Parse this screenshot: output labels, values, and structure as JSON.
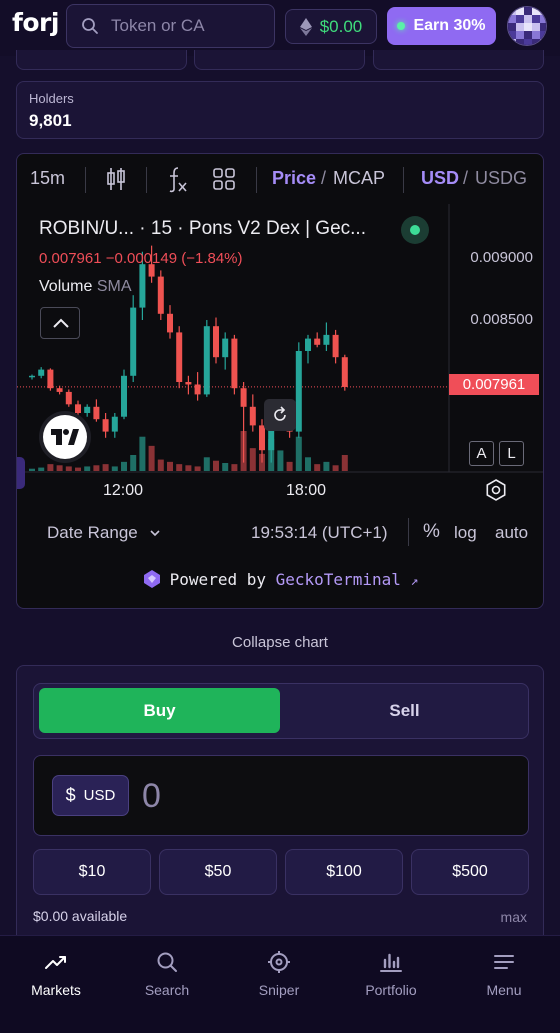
{
  "header": {
    "logo": "forj",
    "search_placeholder": "Token or CA",
    "balance": "$0.00",
    "earn_label": "Earn 30%",
    "avatar_colors": [
      "#3a2a7a",
      "#c9c0ef",
      "#8877d6",
      "#e8e4fa",
      "#4b3a9a"
    ]
  },
  "stats": {
    "holders_label": "Holders",
    "holders_value": "9,801"
  },
  "chart": {
    "toolbar": {
      "interval": "15m",
      "price_label": "Price",
      "sep1": "/",
      "mcap_label": "MCAP",
      "usd_label": "USD",
      "sep2": "/",
      "usdg_label": "USDG"
    },
    "symbol_line": "ROBIN/U... · 15 · Pons V2 Dex | Gec...",
    "ohlc_line": "0.007961  −0.000149 (−1.84%)",
    "volume_label": "Volume",
    "volume_indicator": "SMA",
    "y_axis_labels": [
      "0.009000",
      "0.008500"
    ],
    "current_price_tag": "0.007961",
    "x_axis_labels": [
      "12:00",
      "18:00"
    ],
    "auto_label_a": "A",
    "auto_label_l": "L",
    "date_range_label": "Date Range",
    "timestamp": "19:53:14 (UTC+1)",
    "percent_label": "%",
    "log_label": "log",
    "auto_label": "auto",
    "powered_prefix": "Powered by",
    "powered_brand": "GeckoTerminal",
    "powered_arrow": "↗",
    "colors": {
      "up": "#26a69a",
      "down": "#ef5350",
      "tag": "#f04e58"
    }
  },
  "chart_data": {
    "type": "candlestick",
    "title": "ROBIN/U... · 15 · Pons V2 Dex | Gec...",
    "y_ticks": [
      0.009,
      0.0085
    ],
    "x_ticks": [
      "12:00",
      "18:00"
    ],
    "last_price": 0.007961,
    "change": -0.000149,
    "change_pct": -1.84,
    "candles": [
      {
        "o": 0.00804,
        "h": 0.00806,
        "l": 0.00802,
        "c": 0.00805
      },
      {
        "o": 0.00805,
        "h": 0.00812,
        "l": 0.00803,
        "c": 0.0081
      },
      {
        "o": 0.0081,
        "h": 0.00811,
        "l": 0.00793,
        "c": 0.00795
      },
      {
        "o": 0.00795,
        "h": 0.00797,
        "l": 0.0079,
        "c": 0.00792
      },
      {
        "o": 0.00792,
        "h": 0.00794,
        "l": 0.0078,
        "c": 0.00782
      },
      {
        "o": 0.00782,
        "h": 0.00785,
        "l": 0.0077,
        "c": 0.00775
      },
      {
        "o": 0.00775,
        "h": 0.00782,
        "l": 0.00772,
        "c": 0.0078
      },
      {
        "o": 0.0078,
        "h": 0.00786,
        "l": 0.00768,
        "c": 0.0077
      },
      {
        "o": 0.0077,
        "h": 0.00775,
        "l": 0.00755,
        "c": 0.0076
      },
      {
        "o": 0.0076,
        "h": 0.00775,
        "l": 0.00755,
        "c": 0.00772
      },
      {
        "o": 0.00772,
        "h": 0.0081,
        "l": 0.0077,
        "c": 0.00805
      },
      {
        "o": 0.00805,
        "h": 0.0087,
        "l": 0.008,
        "c": 0.0086
      },
      {
        "o": 0.0086,
        "h": 0.00905,
        "l": 0.0085,
        "c": 0.00895
      },
      {
        "o": 0.00895,
        "h": 0.0091,
        "l": 0.0088,
        "c": 0.00885
      },
      {
        "o": 0.00885,
        "h": 0.0089,
        "l": 0.0085,
        "c": 0.00855
      },
      {
        "o": 0.00855,
        "h": 0.00862,
        "l": 0.00835,
        "c": 0.0084
      },
      {
        "o": 0.0084,
        "h": 0.00845,
        "l": 0.00795,
        "c": 0.008
      },
      {
        "o": 0.008,
        "h": 0.00805,
        "l": 0.0079,
        "c": 0.00798
      },
      {
        "o": 0.00798,
        "h": 0.00808,
        "l": 0.00785,
        "c": 0.0079
      },
      {
        "o": 0.0079,
        "h": 0.0085,
        "l": 0.00788,
        "c": 0.00845
      },
      {
        "o": 0.00845,
        "h": 0.00852,
        "l": 0.00815,
        "c": 0.0082
      },
      {
        "o": 0.0082,
        "h": 0.0084,
        "l": 0.0081,
        "c": 0.00835
      },
      {
        "o": 0.00835,
        "h": 0.00838,
        "l": 0.0079,
        "c": 0.00795
      },
      {
        "o": 0.00795,
        "h": 0.008,
        "l": 0.00735,
        "c": 0.0078
      },
      {
        "o": 0.0078,
        "h": 0.0079,
        "l": 0.0076,
        "c": 0.00765
      },
      {
        "o": 0.00765,
        "h": 0.0077,
        "l": 0.00735,
        "c": 0.00745
      },
      {
        "o": 0.00745,
        "h": 0.00775,
        "l": 0.00735,
        "c": 0.0077
      },
      {
        "o": 0.0077,
        "h": 0.00785,
        "l": 0.00762,
        "c": 0.0078
      },
      {
        "o": 0.0078,
        "h": 0.00785,
        "l": 0.00755,
        "c": 0.0076
      },
      {
        "o": 0.0076,
        "h": 0.00832,
        "l": 0.00755,
        "c": 0.00825
      },
      {
        "o": 0.00825,
        "h": 0.00838,
        "l": 0.00815,
        "c": 0.00835
      },
      {
        "o": 0.00835,
        "h": 0.0084,
        "l": 0.00828,
        "c": 0.0083
      },
      {
        "o": 0.0083,
        "h": 0.00848,
        "l": 0.00825,
        "c": 0.00838
      },
      {
        "o": 0.00838,
        "h": 0.00842,
        "l": 0.00815,
        "c": 0.0082
      },
      {
        "o": 0.0082,
        "h": 0.00822,
        "l": 0.00793,
        "c": 0.00796
      }
    ],
    "volumes": [
      2,
      3,
      6,
      5,
      4,
      3,
      4,
      5,
      6,
      4,
      8,
      14,
      30,
      22,
      10,
      8,
      6,
      5,
      4,
      12,
      9,
      7,
      6,
      35,
      20,
      15,
      28,
      18,
      8,
      30,
      12,
      6,
      8,
      5,
      14
    ]
  },
  "trade": {
    "buy_label": "Buy",
    "sell_label": "Sell",
    "currency_symbol": "$",
    "currency_code": "USD",
    "amount_placeholder": "0",
    "presets": [
      "$10",
      "$50",
      "$100",
      "$500"
    ],
    "available": "$0.00 available",
    "max_label": "max"
  },
  "collapse_label": "Collapse chart",
  "nav": [
    {
      "label": "Markets",
      "icon": "chart-trend-icon",
      "active": true
    },
    {
      "label": "Search",
      "icon": "search-icon",
      "active": false
    },
    {
      "label": "Sniper",
      "icon": "crosshair-icon",
      "active": false
    },
    {
      "label": "Portfolio",
      "icon": "bar-chart-icon",
      "active": false
    },
    {
      "label": "Menu",
      "icon": "menu-icon",
      "active": false
    }
  ]
}
